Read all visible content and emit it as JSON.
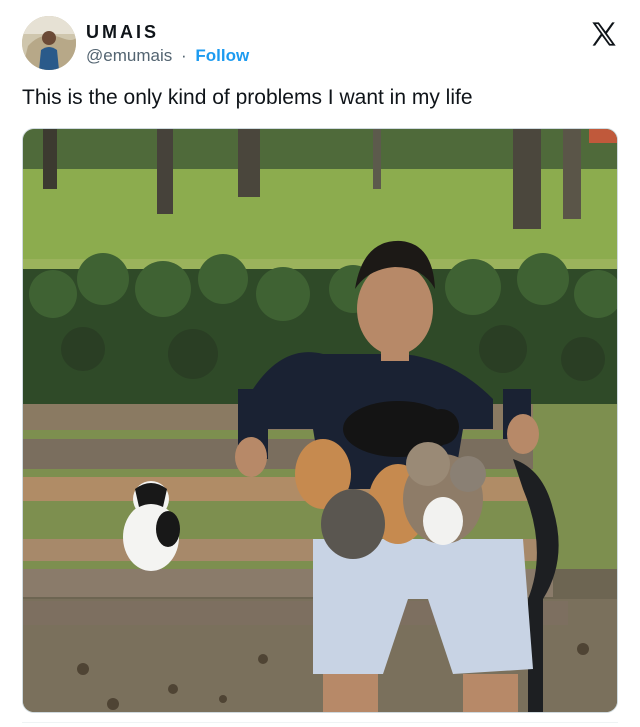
{
  "author": {
    "display_name": "UMAIS",
    "handle": "@emumais",
    "separator": "·",
    "follow_label": "Follow"
  },
  "tweet": {
    "text": "This is the only kind of problems I want in my life"
  },
  "icons": {
    "platform": "x-logo-icon",
    "avatar": "avatar-image"
  },
  "colors": {
    "text": "#0f1419",
    "secondary": "#536471",
    "accent": "#1d9bf0"
  }
}
